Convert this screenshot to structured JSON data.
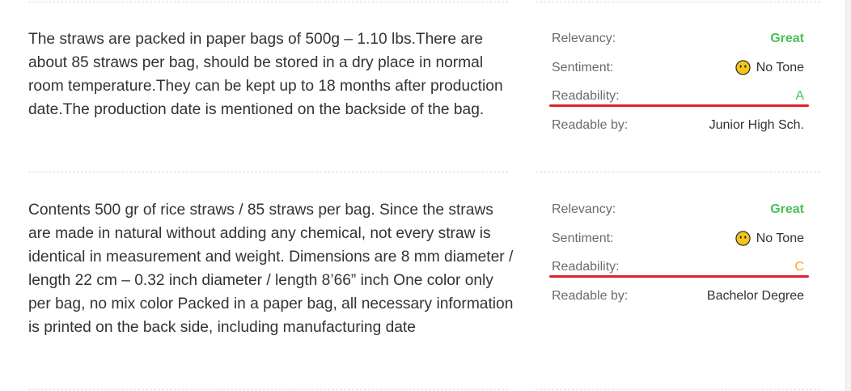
{
  "items": [
    {
      "text": "The straws are packed in paper bags of 500g – 1.10 lbs.There are about 85 straws per bag, should be stored in a dry place in normal room temperature.They can be kept up to 18 months after production date.The production date is mentioned on the backside of the bag.",
      "relevancy_label": "Relevancy:",
      "relevancy_value": "Great",
      "sentiment_label": "Sentiment:",
      "sentiment_value": "No Tone",
      "readability_label": "Readability:",
      "readability_value": "A",
      "readable_by_label": "Readable by:",
      "readable_by_value": "Junior High Sch."
    },
    {
      "text": "Contents 500 gr of rice straws / 85 straws per bag. Since the straws are made in natural without adding any chemical, not every straw is identical in measurement and weight. Dimensions are 8 mm diameter / length 22 cm – 0.32 inch diameter / length 8’66” inch One color only per bag, no mix color Packed in a paper bag, all necessary information is printed on the back side, including manufacturing date",
      "relevancy_label": "Relevancy:",
      "relevancy_value": "Great",
      "sentiment_label": "Sentiment:",
      "sentiment_value": "No Tone",
      "readability_label": "Readability:",
      "readability_value": "C",
      "readable_by_label": "Readable by:",
      "readable_by_value": "Bachelor Degree"
    }
  ],
  "icons": {
    "sentiment": "neutral-face-icon"
  },
  "colors": {
    "great": "#4cbf5a",
    "grade_a": "#4cbf5a",
    "grade_c": "#f5a623",
    "highlight_underline": "#e0202a",
    "label": "#6b6b6b",
    "text": "#333333"
  }
}
